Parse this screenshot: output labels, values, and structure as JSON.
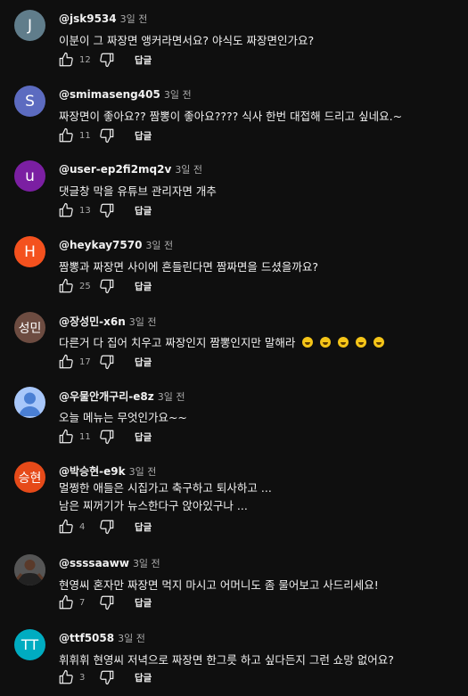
{
  "reply_label": "답글",
  "icons": {
    "like": "thumbs-up-icon",
    "dislike": "thumbs-down-icon"
  },
  "comments": [
    {
      "avatar_text": "J",
      "avatar_color": "#607d8b",
      "author": "@jsk9534",
      "time": "3일 전",
      "text": [
        "이분이 그 짜장면 앵커라면서요? 야식도 짜장면인가요?"
      ],
      "likes": "12"
    },
    {
      "avatar_text": "S",
      "avatar_color": "#5c6bc0",
      "author": "@smimaseng405",
      "time": "3일 전",
      "text": [
        "짜장면이 좋아요?? 짬뽕이 좋아요???? 식사 한번 대접해 드리고 싶네요.~"
      ],
      "likes": "11"
    },
    {
      "avatar_text": "u",
      "avatar_color": "#7b1fa2",
      "author": "@user-ep2fi2mq2v",
      "time": "3일 전",
      "text": [
        "댓글창 막을 유튜브 관리자면 개추"
      ],
      "likes": "13"
    },
    {
      "avatar_text": "H",
      "avatar_color": "#f4511e",
      "author": "@heykay7570",
      "time": "3일 전",
      "text": [
        "짬뽕과 짜장면 사이에 흔들린다면 짬짜면을 드셨을까요?"
      ],
      "likes": "25"
    },
    {
      "avatar_text": "성민",
      "avatar_color": "#6d4c41",
      "author": "@장성민-x6n",
      "time": "3일 전",
      "text": [
        "다른거 다 집어 치우고 짜장인지 짬뽕인지만 말해라"
      ],
      "emoji_count": 5,
      "likes": "17"
    },
    {
      "avatar_text": "",
      "avatar_color": "#a8c7fa",
      "author": "@우물안개구리-e8z",
      "time": "3일 전",
      "text": [
        "오늘 메뉴는 무엇인가요~~"
      ],
      "likes": "11"
    },
    {
      "avatar_text": "승현",
      "avatar_color": "#e64a19",
      "author": "@박승현-e9k",
      "time": "3일 전",
      "text": [
        "멀쩡한 애들은 시집가고  축구하고  퇴사하고  ...",
        "남은 찌꺼기가 뉴스한다구 앉아있구나 ..."
      ],
      "likes": "4"
    },
    {
      "avatar_text": "",
      "avatar_color": "#3a3a3a",
      "author": "@ssssaaww",
      "time": "3일 전",
      "text": [
        "현영씨 혼자만 짜장면 먹지 마시고 어머니도 좀 물어보고 사드리세요!"
      ],
      "likes": "7"
    },
    {
      "avatar_text": "TT",
      "avatar_color": "#00acc1",
      "author": "@ttf5058",
      "time": "3일 전",
      "text": [
        "휘휘휘 현영씨 저녁으로 짜장면 한그릇 하고 싶다든지 그런 쇼망 없어요?"
      ],
      "likes": "3"
    }
  ]
}
